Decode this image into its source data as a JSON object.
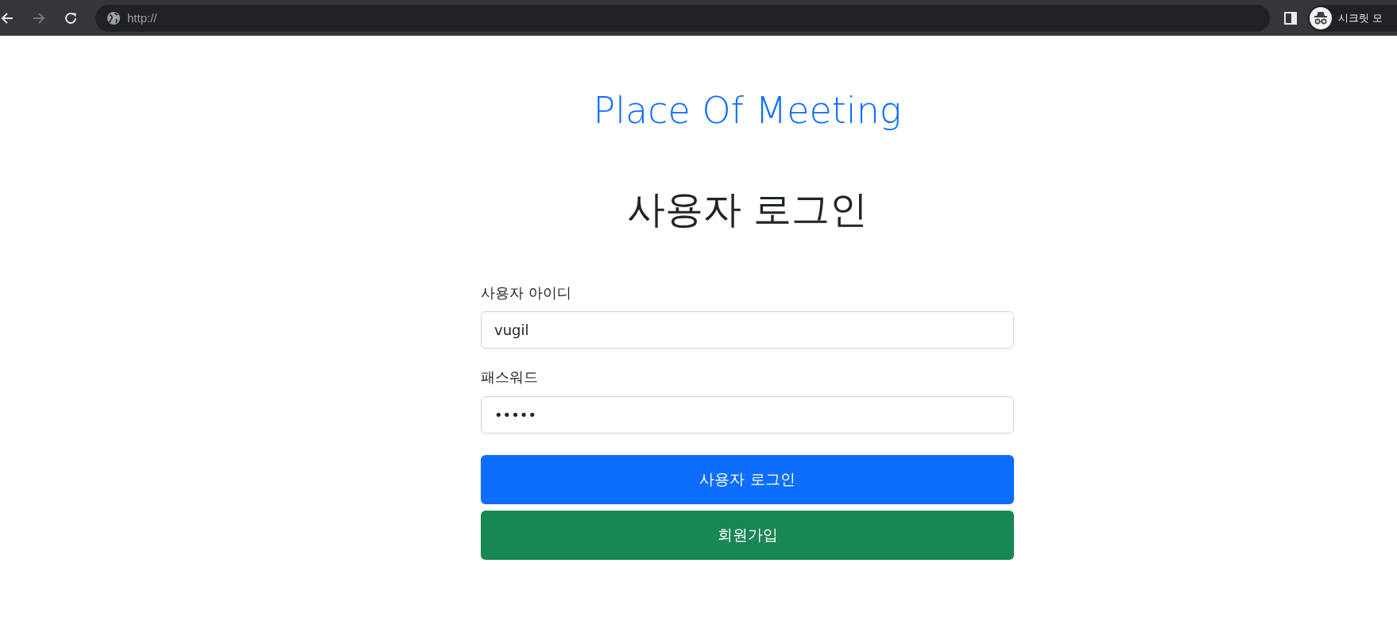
{
  "browser": {
    "nav_buttons": [
      {
        "kind": "back",
        "disabled": false
      },
      {
        "kind": "forward",
        "disabled": true
      },
      {
        "kind": "reload",
        "disabled": false
      }
    ],
    "url": "http://",
    "profile_label": "시크릿 모"
  },
  "page": {
    "title": "Place Of Meeting",
    "heading": "사용자 로그인"
  },
  "form": {
    "fields": [
      {
        "label": "사용자 아이디",
        "value": "vugil",
        "kind": "text"
      },
      {
        "label": "패스워드",
        "value": "•••••",
        "kind": "password"
      }
    ],
    "buttons": [
      {
        "label": "사용자 로그인",
        "kind": "primary"
      },
      {
        "label": "회원가입",
        "kind": "success"
      }
    ]
  }
}
